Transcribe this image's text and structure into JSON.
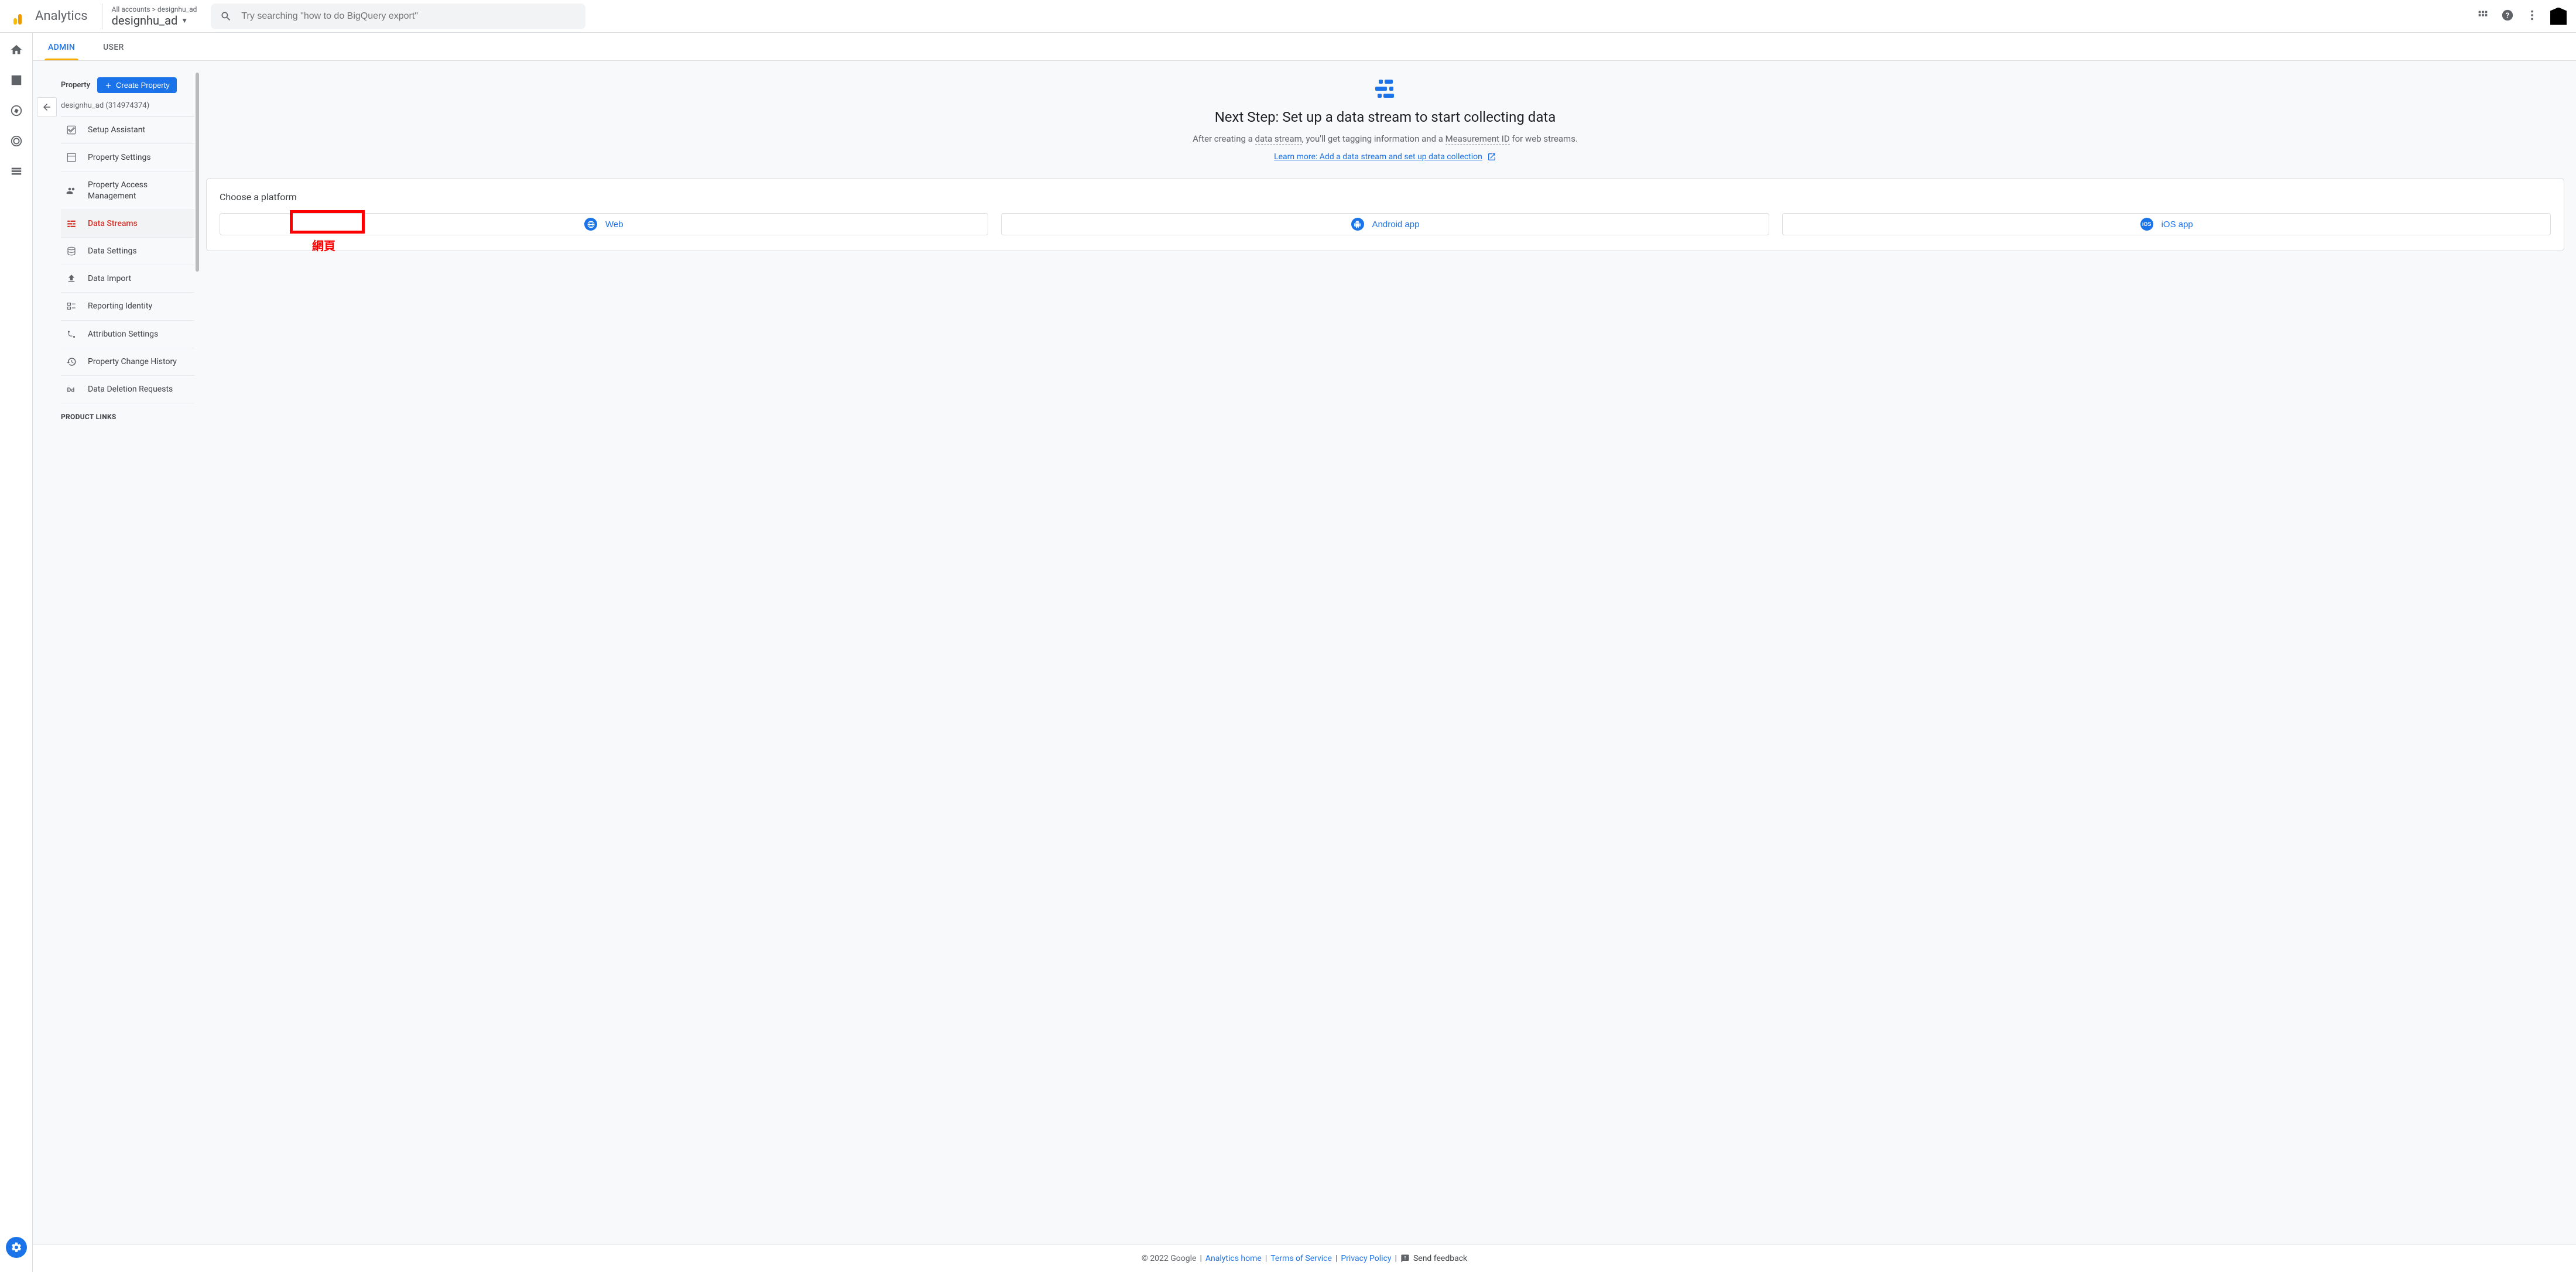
{
  "header": {
    "app_name": "Analytics",
    "account_path": "All accounts > designhu_ad",
    "account_selected": "designhu_ad",
    "search_placeholder": "Try searching \"how to do BigQuery export\""
  },
  "tabs": {
    "admin": "ADMIN",
    "user": "USER"
  },
  "sidebar": {
    "property_label": "Property",
    "create_property": "Create Property",
    "property_name": "designhu_ad (314974374)",
    "items": [
      {
        "label": "Setup Assistant"
      },
      {
        "label": "Property Settings"
      },
      {
        "label": "Property Access Management"
      },
      {
        "label": "Data Streams"
      },
      {
        "label": "Data Settings"
      },
      {
        "label": "Data Import"
      },
      {
        "label": "Reporting Identity"
      },
      {
        "label": "Attribution Settings"
      },
      {
        "label": "Property Change History"
      },
      {
        "label": "Data Deletion Requests"
      }
    ],
    "section_product_links": "PRODUCT LINKS"
  },
  "main": {
    "title": "Next Step: Set up a data stream to start collecting data",
    "desc_pre": "After creating a ",
    "desc_ds": "data stream",
    "desc_mid": ", you'll get tagging information and a ",
    "desc_mid2": "Measurement ID",
    "desc_post": " for web streams.",
    "learn_more": "Learn more: Add a data stream and set up data collection",
    "choose": "Choose a platform",
    "platforms": {
      "web": "Web",
      "android": "Android app",
      "ios": "iOS app"
    },
    "annotation_web": "網頁"
  },
  "footer": {
    "copyright": "© 2022 Google",
    "analytics_home": "Analytics home",
    "terms": "Terms of Service",
    "privacy": "Privacy Policy",
    "feedback": "Send feedback"
  }
}
